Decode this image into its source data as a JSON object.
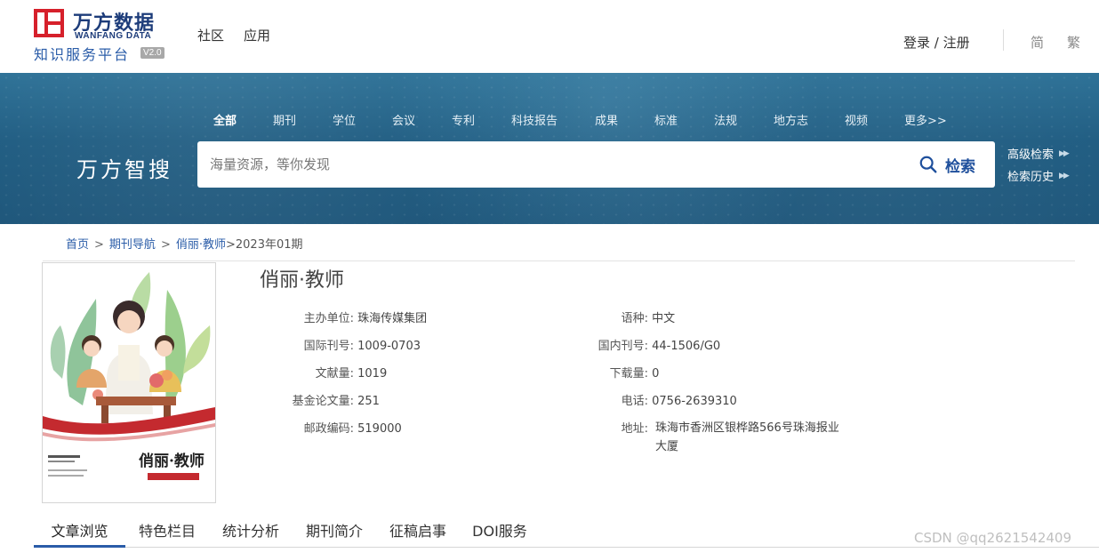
{
  "logo": {
    "name_cn": "万方数据",
    "name_en": "WANFANG DATA",
    "subtitle": "知识服务平台",
    "version": "V2.0"
  },
  "top_nav": [
    {
      "label": "社区"
    },
    {
      "label": "应用"
    }
  ],
  "auth": {
    "label": "登录 / 注册"
  },
  "lang": {
    "simplified": "简",
    "traditional": "繁"
  },
  "search": {
    "brand": "万方智搜",
    "placeholder": "海量资源，等你发现",
    "button": "检索",
    "advanced": "高级检索",
    "history": "检索历史",
    "categories": [
      {
        "label": "全部",
        "active": true
      },
      {
        "label": "期刊"
      },
      {
        "label": "学位"
      },
      {
        "label": "会议"
      },
      {
        "label": "专利"
      },
      {
        "label": "科技报告"
      },
      {
        "label": "成果"
      },
      {
        "label": "标准"
      },
      {
        "label": "法规"
      },
      {
        "label": "地方志"
      },
      {
        "label": "视频"
      },
      {
        "label": "更多>>"
      }
    ]
  },
  "breadcrumb": {
    "home": "首页",
    "journal_nav": "期刊导航",
    "journal": "俏丽·教师",
    "issue": ">2023年01期"
  },
  "journal": {
    "title": "俏丽·教师",
    "cover_title": "俏丽·教师",
    "sponsor_label": "主办单位:",
    "sponsor": "珠海传媒集团",
    "issn_label": "国际刊号:",
    "issn": "1009-0703",
    "docs_label": "文献量:",
    "docs": "1019",
    "fund_label": "基金论文量:",
    "fund": "251",
    "postcode_label": "邮政编码:",
    "postcode": "519000",
    "language_label": "语种:",
    "language": "中文",
    "cn_label": "国内刊号:",
    "cn": "44-1506/G0",
    "downloads_label": "下载量:",
    "downloads": "0",
    "phone_label": "电话:",
    "phone": "0756-2639310",
    "address_label": "地址:",
    "address": "珠海市香洲区银桦路566号珠海报业大厦"
  },
  "tabs": [
    {
      "label": "文章浏览",
      "active": true
    },
    {
      "label": "特色栏目"
    },
    {
      "label": "统计分析"
    },
    {
      "label": "期刊简介"
    },
    {
      "label": "征稿启事"
    },
    {
      "label": "DOI服务"
    }
  ],
  "watermark": "CSDN @qq2621542409",
  "colors": {
    "brand_red": "#d6202b",
    "brand_blue": "#1d3c7a",
    "link_blue": "#2a5ca8",
    "banner": "#1c5a80"
  }
}
